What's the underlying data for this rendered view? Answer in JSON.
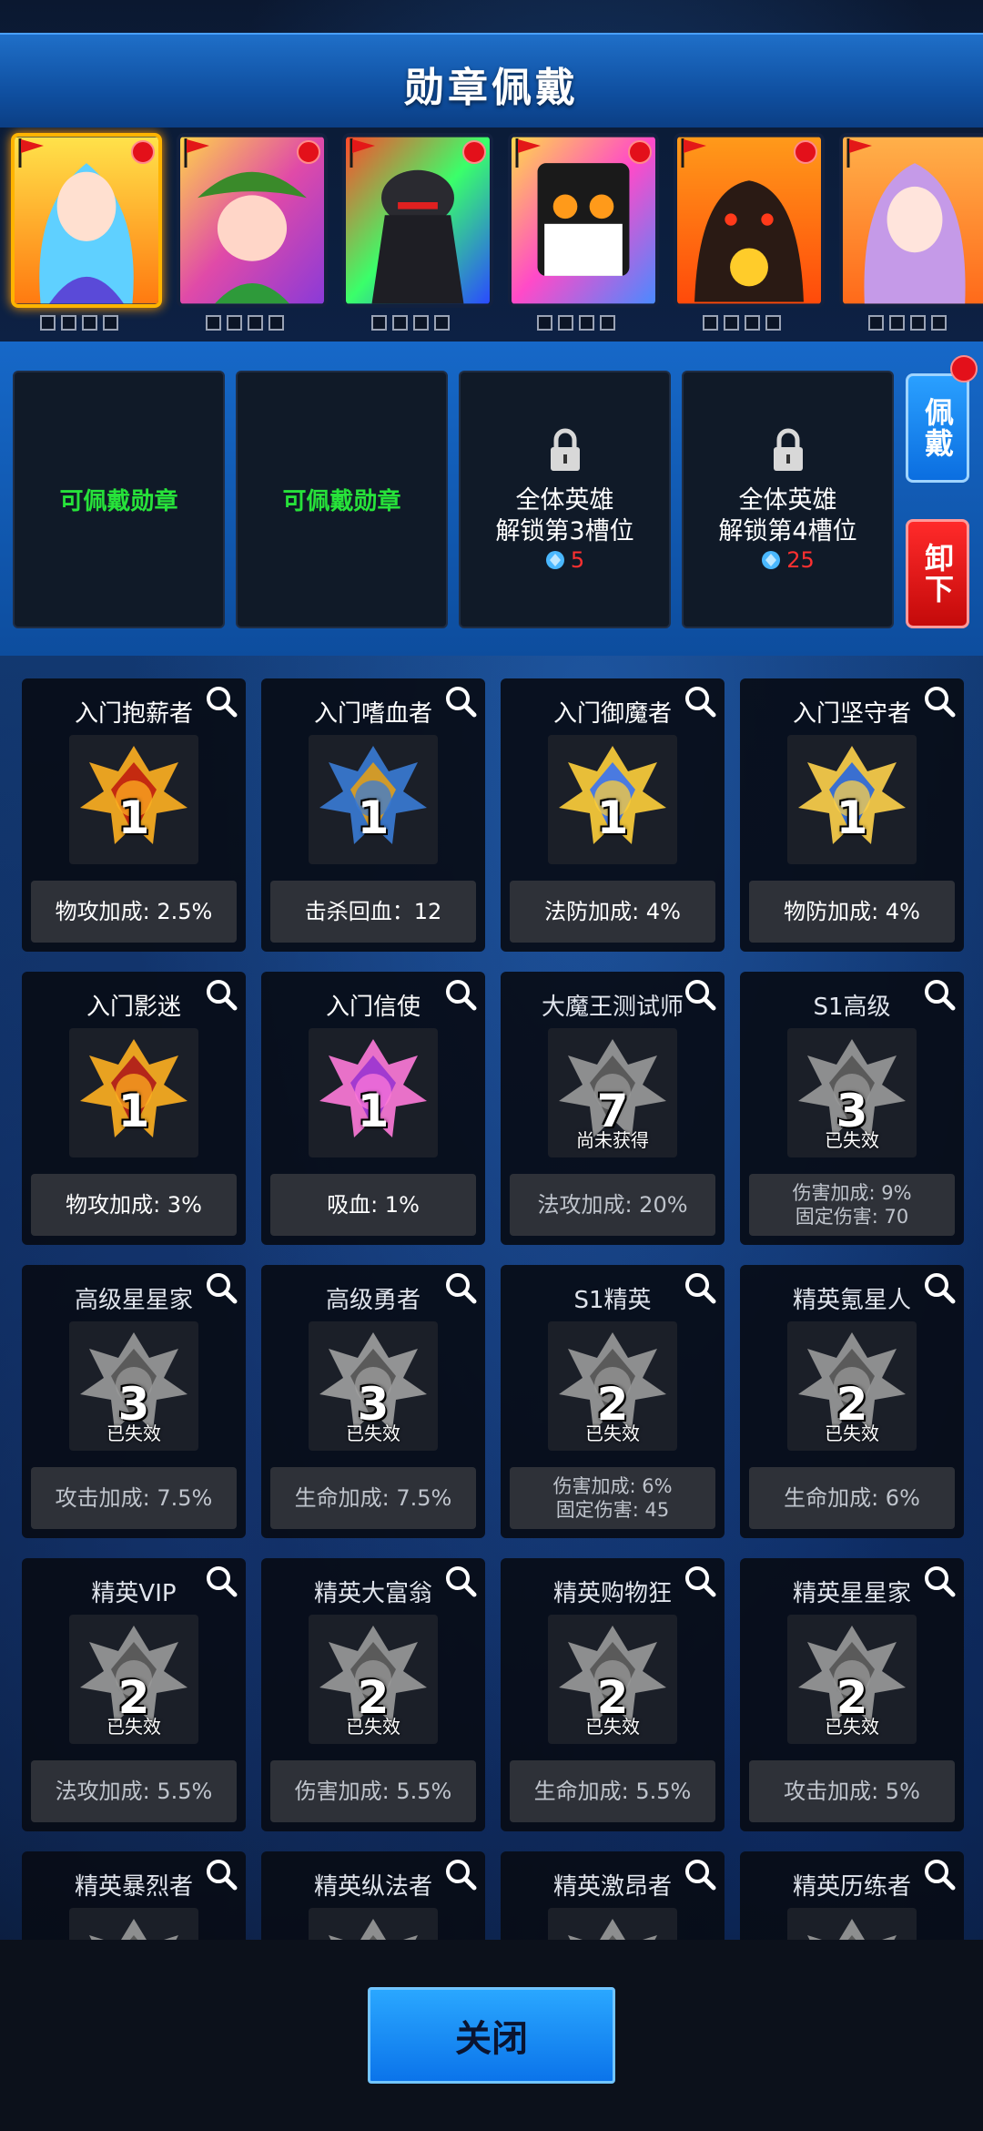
{
  "title": "勋章佩戴",
  "heroes": [
    {
      "name": "hero-blue-hair-girl",
      "selected": true
    },
    {
      "name": "hero-leaf-girl",
      "selected": false
    },
    {
      "name": "hero-dark-warrior",
      "selected": false
    },
    {
      "name": "hero-black-cat",
      "selected": false
    },
    {
      "name": "hero-lava-demon",
      "selected": false
    },
    {
      "name": "hero-purple-hair-girl",
      "selected": false
    }
  ],
  "equip_slots": [
    {
      "type": "available",
      "label": "可佩戴勋章"
    },
    {
      "type": "available",
      "label": "可佩戴勋章"
    },
    {
      "type": "locked",
      "line1": "全体英雄",
      "line2": "解锁第3槽位",
      "cost": "5"
    },
    {
      "type": "locked",
      "line1": "全体英雄",
      "line2": "解锁第4槽位",
      "cost": "25"
    }
  ],
  "buttons": {
    "wear": "佩戴",
    "unload": "卸下",
    "close": "关闭"
  },
  "medals": [
    {
      "name": "入门抱薪者",
      "level": "1",
      "state": "",
      "bonus": [
        "物攻加成: 2.5%"
      ],
      "colors": [
        "#ffb020",
        "#c42a10"
      ]
    },
    {
      "name": "入门嗜血者",
      "level": "1",
      "state": "",
      "bonus": [
        "击杀回血：12"
      ],
      "colors": [
        "#3a7bd5",
        "#d09a2a"
      ]
    },
    {
      "name": "入门御魔者",
      "level": "1",
      "state": "",
      "bonus": [
        "法防加成: 4%"
      ],
      "colors": [
        "#ffcf3a",
        "#4a7ae0"
      ]
    },
    {
      "name": "入门坚守者",
      "level": "1",
      "state": "",
      "bonus": [
        "物防加成: 4%"
      ],
      "colors": [
        "#ffd24a",
        "#3a6fd0"
      ]
    },
    {
      "name": "入门影迷",
      "level": "1",
      "state": "",
      "bonus": [
        "物攻加成: 3%"
      ],
      "colors": [
        "#ffb020",
        "#b4261a"
      ]
    },
    {
      "name": "入门信使",
      "level": "1",
      "state": "",
      "bonus": [
        "吸血: 1%"
      ],
      "colors": [
        "#ff7ad9",
        "#a23ad0"
      ]
    },
    {
      "name": "大魔王测试师",
      "level": "7",
      "state": "尚未获得",
      "bonus": [
        "法攻加成: 20%"
      ],
      "colors": [
        "#9a9a9a",
        "#5a5a5a"
      ]
    },
    {
      "name": "S1高级",
      "level": "3",
      "state": "已失效",
      "bonus": [
        "伤害加成: 9%",
        "固定伤害: 70"
      ],
      "colors": [
        "#9a9a9a",
        "#5a5a5a"
      ]
    },
    {
      "name": "高级星星家",
      "level": "3",
      "state": "已失效",
      "bonus": [
        "攻击加成: 7.5%"
      ],
      "colors": [
        "#9a9a9a",
        "#5a5a5a"
      ]
    },
    {
      "name": "高级勇者",
      "level": "3",
      "state": "已失效",
      "bonus": [
        "生命加成: 7.5%"
      ],
      "colors": [
        "#a0a0a0",
        "#5a5a5a"
      ]
    },
    {
      "name": "S1精英",
      "level": "2",
      "state": "已失效",
      "bonus": [
        "伤害加成: 6%",
        "固定伤害: 45"
      ],
      "colors": [
        "#9a9a9a",
        "#5a5a5a"
      ]
    },
    {
      "name": "精英氪星人",
      "level": "2",
      "state": "已失效",
      "bonus": [
        "生命加成: 6%"
      ],
      "colors": [
        "#9a9a9a",
        "#5a5a5a"
      ]
    },
    {
      "name": "精英VIP",
      "level": "2",
      "state": "已失效",
      "bonus": [
        "法攻加成: 5.5%"
      ],
      "colors": [
        "#9a9a9a",
        "#5a5a5a"
      ]
    },
    {
      "name": "精英大富翁",
      "level": "2",
      "state": "已失效",
      "bonus": [
        "伤害加成: 5.5%"
      ],
      "colors": [
        "#9a9a9a",
        "#5a5a5a"
      ]
    },
    {
      "name": "精英购物狂",
      "level": "2",
      "state": "已失效",
      "bonus": [
        "生命加成: 5.5%"
      ],
      "colors": [
        "#9a9a9a",
        "#5a5a5a"
      ]
    },
    {
      "name": "精英星星家",
      "level": "2",
      "state": "已失效",
      "bonus": [
        "攻击加成: 5%"
      ],
      "colors": [
        "#9a9a9a",
        "#5a5a5a"
      ]
    },
    {
      "name": "精英暴烈者",
      "level": "",
      "state": "",
      "bonus": [],
      "colors": [
        "#9a9a9a",
        "#5a5a5a"
      ]
    },
    {
      "name": "精英纵法者",
      "level": "",
      "state": "",
      "bonus": [],
      "colors": [
        "#9a9a9a",
        "#5a5a5a"
      ]
    },
    {
      "name": "精英激昂者",
      "level": "",
      "state": "",
      "bonus": [],
      "colors": [
        "#9a9a9a",
        "#5a5a5a"
      ]
    },
    {
      "name": "精英历练者",
      "level": "",
      "state": "",
      "bonus": [],
      "colors": [
        "#9a9a9a",
        "#5a5a5a"
      ]
    }
  ]
}
